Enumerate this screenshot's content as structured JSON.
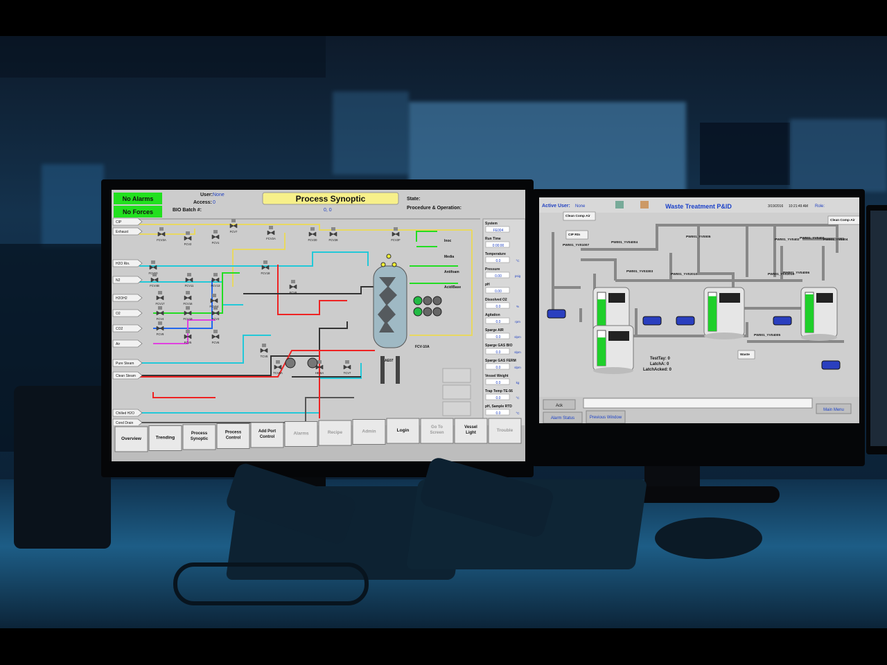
{
  "left_screen": {
    "alarm_badge": "No Alarms",
    "forces_badge": "No Forces",
    "user_label": "User:",
    "user_value": "None",
    "access_label": "Access:",
    "access_value": "0",
    "batch_label": "BIO Batch #:",
    "title": "Process Synoptic",
    "state_label": "State:",
    "procedure_label": "Procedure & Operation:",
    "zero_value": "0, 0",
    "inputs": [
      "CIP",
      "Exhaust",
      "H2O Rin.",
      "N2",
      "H2OH2",
      "O2",
      "CO2",
      "Air",
      "Pure Steam",
      "Clean Steam",
      "Chilled H2O",
      "Cond Drain"
    ],
    "valves": [
      "FCV3A",
      "FCV2",
      "FCV1",
      "FCV7",
      "FCV2A",
      "FCV20",
      "FCV28",
      "FCV2F",
      "FCV10",
      "FCV18",
      "FCV4B",
      "FCV11",
      "FCV13",
      "FCV8",
      "FCV17",
      "FCV16",
      "FCV14",
      "FCV4",
      "FCV19",
      "FCV3",
      "FCV9",
      "FCV5",
      "FCV6",
      "TCV8",
      "TCV6A",
      "HE-6A",
      "TCV7"
    ],
    "right_labels": [
      "Inoc",
      "Media",
      "Antifoam",
      "Acid/Base",
      "FCV-10A",
      "AE07"
    ],
    "sidebar": [
      {
        "label": "System",
        "value": "FE004"
      },
      {
        "label": "Run Time",
        "value": "0:00:00"
      },
      {
        "label": "Temperature",
        "value": "0.0"
      },
      {
        "label": "Pressure",
        "value": "0.00"
      },
      {
        "label": "pH",
        "value": "0.00"
      },
      {
        "label": "Dissolved O2",
        "value": "0.0"
      },
      {
        "label": "Agitation",
        "value": "0.0"
      },
      {
        "label": "Sparge AIR",
        "value": "0.0"
      },
      {
        "label": "Sparge GAS BIO",
        "value": "0.0"
      },
      {
        "label": "Sparge GAS FERM",
        "value": "0.0"
      },
      {
        "label": "Vessel Weight",
        "value": "0.0"
      },
      {
        "label": "Trap Temp TE-56",
        "value": "0.0"
      },
      {
        "label": "pH, Sample RTD",
        "value": "0.0"
      }
    ],
    "sidebar_units": [
      "",
      "",
      "°C",
      "psig",
      "",
      "%",
      "rpm",
      "slpm",
      "slpm",
      "slpm",
      "kg",
      "°C",
      "°C"
    ],
    "nav_buttons": [
      "Overview",
      "Trending",
      "Process Synoptic",
      "Process Control",
      "Add Port Control",
      "Alarms",
      "Recipe",
      "Admin",
      "Login",
      "Go To Screen",
      "Vessel Light",
      "Trouble"
    ]
  },
  "right_screen": {
    "active_user_label": "Active User:",
    "active_user_value": "None",
    "title": "Waste Treatment P&ID",
    "date": "3/19/2016",
    "time": "10:21:49 AM",
    "role_label": "Role:",
    "labels": [
      "Clean Comp Air",
      "CIP Rtn",
      "PW001_YV01007",
      "PW001_YV04004",
      "PW001_YV03303",
      "PW001_YV02010",
      "PW001_YV0005",
      "PW001_YV0402",
      "PW001_YV0403",
      "PW001_YV0404",
      "PW001_YV02016",
      "PW001_YV04005",
      "Clean Comp Air",
      "PW001_YV04006",
      "Waste"
    ],
    "status_lines": [
      "TestTay: 0",
      "LatchA: 0",
      "LatchAcked: 0"
    ],
    "ack_button": "Ack",
    "alarm_status_button": "Alarm Status",
    "previous_window_button": "Previous Window",
    "main_menu_button": "Main Menu"
  },
  "colors": {
    "alarm_green": "#22e01f",
    "title_yellow": "#f7f08a",
    "screen_gray": "#cfcfcf",
    "tank_green": "#1fcf2a",
    "pipe_red": "#ee2222",
    "pipe_cyan": "#22c8d8",
    "pipe_green": "#22dd22",
    "pipe_magenta": "#e040e0",
    "pipe_yellow": "#e8d860",
    "pipe_blue": "#2266ee"
  }
}
